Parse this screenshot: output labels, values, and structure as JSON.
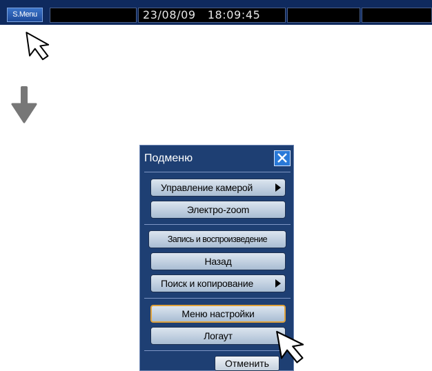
{
  "topbar": {
    "menu_button": "S.Menu",
    "datetime": "23/08/09   18:09:45"
  },
  "submenu": {
    "title": "Подменю",
    "items": [
      {
        "label": "Управление камерой",
        "has_submenu": true
      },
      {
        "label": "Электро-zoom",
        "has_submenu": false
      },
      {
        "label": "Запись и воспроизведение",
        "has_submenu": false
      },
      {
        "label": "Назад",
        "has_submenu": false
      },
      {
        "label": "Поиск и копирование",
        "has_submenu": true
      },
      {
        "label": "Меню настройки",
        "has_submenu": false,
        "selected": true
      },
      {
        "label": "Логаут",
        "has_submenu": false
      }
    ],
    "cancel_label": "Отменить"
  },
  "icons": {
    "close": "close-icon",
    "flow_arrow": "arrow-down-icon",
    "cursor": "mouse-pointer-icon"
  },
  "colors": {
    "bar": "#0f2a5e",
    "panel": "#1e3f73",
    "button": "#c7d4e2",
    "selected_outline": "#e0a23a",
    "close": "#2979d8",
    "flow_arrow": "#777777"
  }
}
